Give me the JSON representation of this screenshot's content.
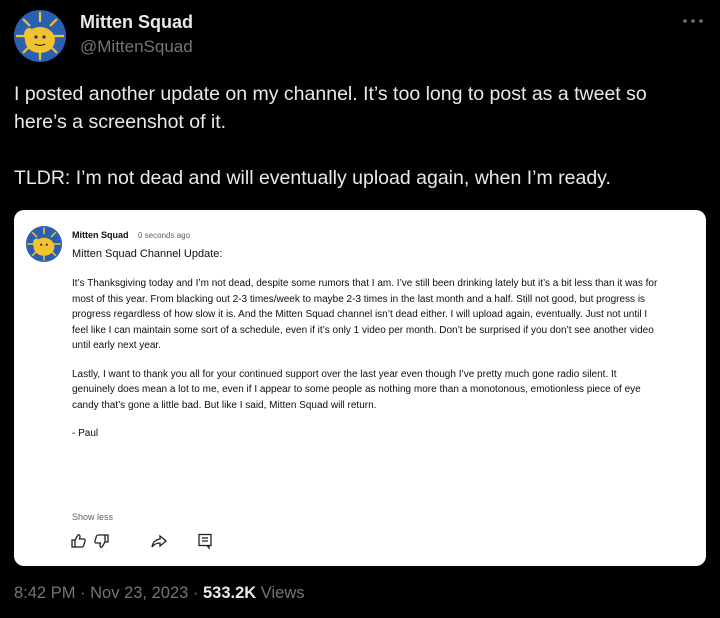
{
  "author": {
    "name": "Mitten Squad",
    "handle": "@MittenSquad",
    "more_icon": "more-horizontal-icon"
  },
  "tweet": {
    "paragraphs": [
      "I posted another update on my channel. It’s too long to post as a tweet so here’s a screenshot of it.",
      "TLDR: I’m not dead and will eventually upload again, when I’m ready."
    ],
    "time": "8:42 PM",
    "date": "Nov 23, 2023",
    "views_count": "533.2K",
    "views_label": "Views"
  },
  "screenshot": {
    "author": "Mitten Squad",
    "time": "0 seconds ago",
    "title": "Mitten Squad Channel Update:",
    "paragraphs": [
      "It’s Thanksgiving today and I’m not dead, despite some rumors that I am. I’ve still been drinking lately but it’s a bit less than it was for most of this year. From blacking out 2-3 times/week  to maybe 2-3 times in the last month and a half. Still not good, but progress is progress regardless of how slow it is. And the Mitten Squad channel isn’t dead either. I will upload again, eventually. Just not until I feel like I can maintain some sort of a schedule, even if it’s only 1 video per month. Don’t be surprised if you don’t see another video until early next year.",
      "Lastly, I want to thank you all for your continued support over the last year even though I’ve pretty much gone radio silent. It genuinely does mean a lot to me, even if I appear to some people as nothing more than a monotonous, emotionless piece of eye candy that’s gone a little bad. But like I said, Mitten Squad will return.",
      "- Paul"
    ],
    "show_less": "Show less",
    "action_icons": [
      "thumbs-up-icon",
      "thumbs-down-icon",
      "share-icon",
      "comment-icon"
    ]
  },
  "colors": {
    "background": "#000000",
    "text": "#e7e9ea",
    "muted": "#71767b",
    "avatar_blue": "#2b5fb0",
    "mitten_yellow": "#f2c230"
  }
}
